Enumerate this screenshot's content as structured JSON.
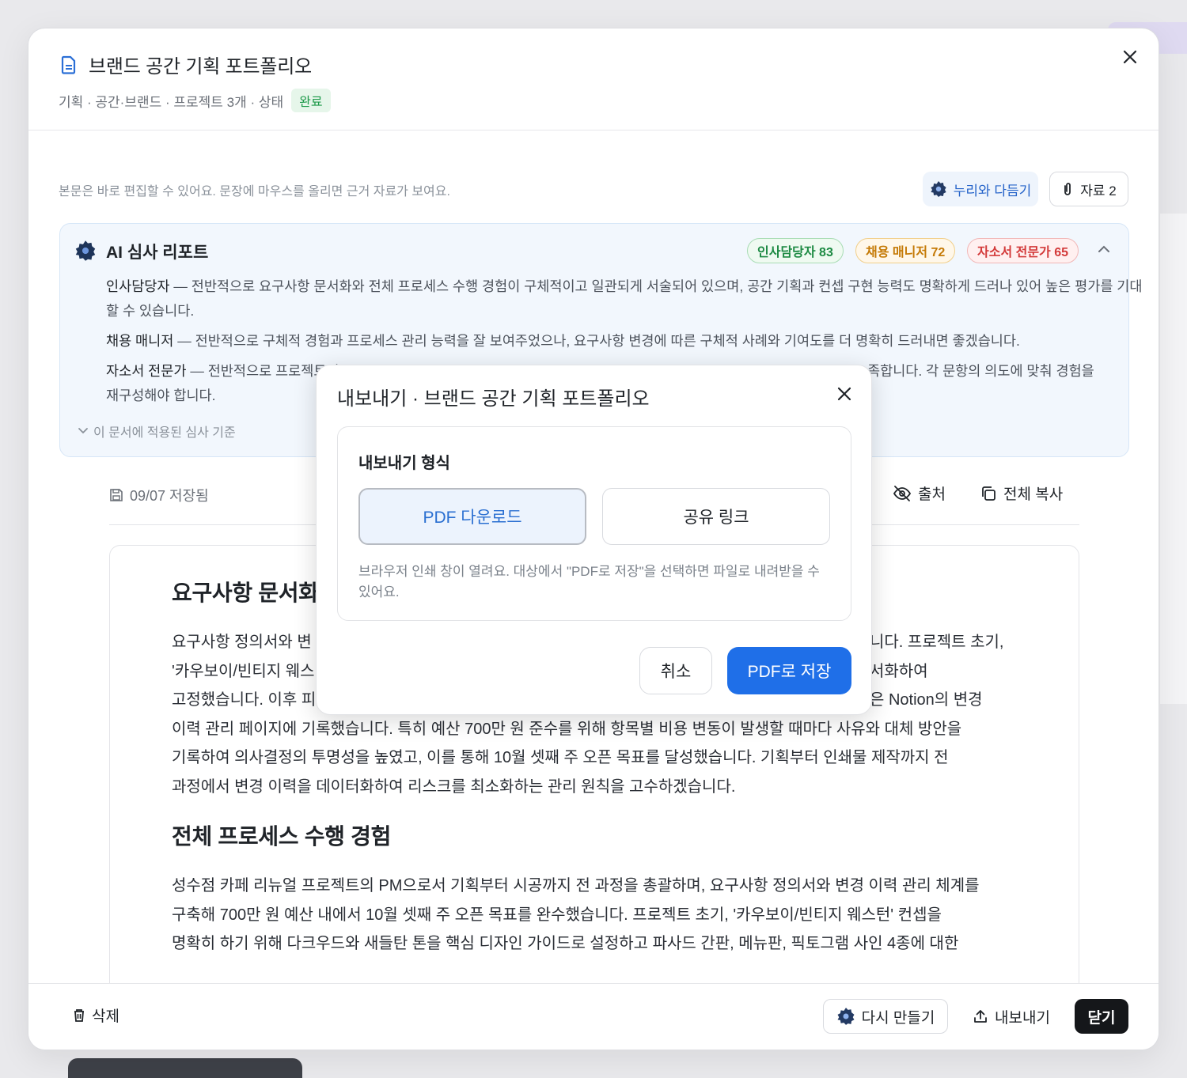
{
  "document": {
    "title": "브랜드 공간 기획 포트폴리오",
    "meta": "기획 · 공간·브랜드 · 프로젝트 3개 · 상태",
    "status": "완료"
  },
  "hint": "본문은 바로 편집할 수 있어요. 문장에 마우스를 올리면 근거 자료가 보여요.",
  "actions": {
    "nuri_label": "누리와 다듬기",
    "files_label": "자료 2"
  },
  "ai_report": {
    "title": "AI 심사 리포트",
    "scores": [
      "인사담당자 83",
      "채용 매니저 72",
      "자소서 전문가 65"
    ],
    "reviews": [
      {
        "role": "인사담당자",
        "text": " — 전반적으로 요구사항 문서화와 전체 프로세스 수행 경험이 구체적이고 일관되게 서술되어 있으며, 공간 기획과 컨셉 구현 능력도 명확하게 드러나 있어 높은 평가를 기대할 수 있습니다."
      },
      {
        "role": "채용 매니저",
        "text": " — 전반적으로 구체적 경험과 프로세스 관리 능력을 잘 보여주었으나, 요구사항 변경에 따른 구체적 사례와 기여도를 더 명확히 드러내면 좋겠습니다."
      },
      {
        "role": "자소서 전문가",
        "text_before": " — 전반적으로 프로젝트의 ",
        "text_after": "족합니다. 각 문항의 의도에 맞춰 경험을",
        "text_line2": "재구성해야 합니다."
      }
    ],
    "criteria_label": "이 문서에 적용된 심사 기준"
  },
  "toolbar": {
    "saved": "09/07 저장됨",
    "source": "출처",
    "copy_all": "전체 복사"
  },
  "content": {
    "section1_title": "요구사항 문서화",
    "section1_lines": [
      "요구사항 정의서와 변",
      "'카우보이/빈티지 웨스",
      "고정했습니다. 이후 피"
    ],
    "section1_right": [
      "니다. 프로젝트 초기,",
      "서화하여",
      "은 Notion의 변경"
    ],
    "section1_full": [
      "이력 관리 페이지에 기록했습니다. 특히 예산 700만 원 준수를 위해 항목별 비용 변동이 발생할 때마다 사유와 대체 방안을",
      "기록하여 의사결정의 투명성을 높였고, 이를 통해 10월 셋째 주 오픈 목표를 달성했습니다. 기획부터 인쇄물 제작까지 전",
      "과정에서 변경 이력을 데이터화하여 리스크를 최소화하는 관리 원칙을 고수하겠습니다."
    ],
    "section2_title": "전체 프로세스 수행 경험",
    "section2_lines": [
      "성수점 카페 리뉴얼 프로젝트의 PM으로서 기획부터 시공까지 전 과정을 총괄하며, 요구사항 정의서와 변경 이력 관리 체계를",
      "구축해 700만 원 예산 내에서 10월 셋째 주 오픈 목표를 완수했습니다. 프로젝트 초기, '카우보이/빈티지 웨스턴' 컨셉을",
      "명확히 하기 위해 다크우드와 새들탄 톤을 핵심 디자인 가이드로 설정하고 파사드 간판, 메뉴판, 픽토그램 사인 4종에 대한"
    ]
  },
  "footer": {
    "delete": "삭제",
    "regenerate": "다시 만들기",
    "export": "내보내기",
    "close": "닫기"
  },
  "export_dialog": {
    "title": "내보내기 · 브랜드 공간 기획 포트폴리오",
    "format_label": "내보내기 형식",
    "option_pdf": "PDF 다운로드",
    "option_link": "공유 링크",
    "description": "브라우저 인쇄 창이 열려요. 대상에서 \"PDF로 저장\"을 선택하면 파일로 내려받을 수 있어요.",
    "cancel": "취소",
    "save": "PDF로 저장"
  },
  "colors": {
    "accent": "#1f6fe8",
    "status_green": "#1e9a4a",
    "score_green": "#1d8a43",
    "score_orange": "#c57a06",
    "score_red": "#d33a3a"
  }
}
